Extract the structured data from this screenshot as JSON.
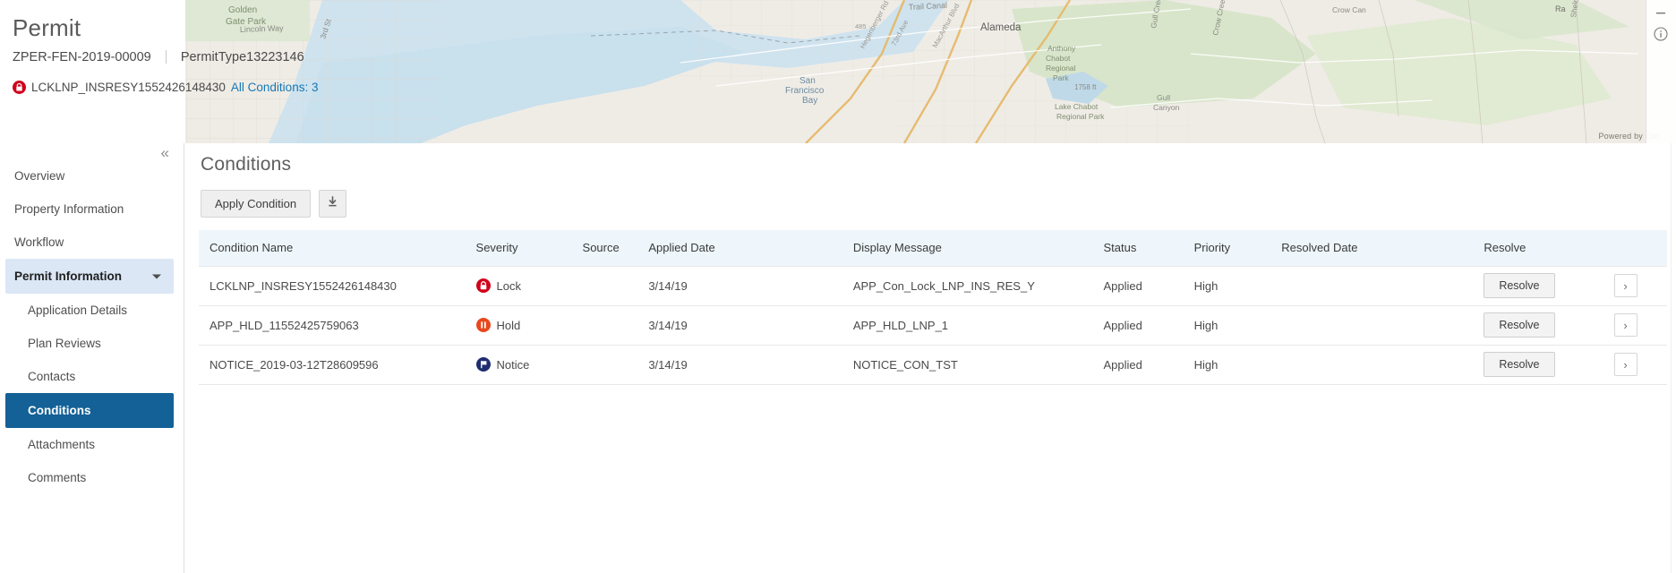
{
  "header": {
    "title": "Permit",
    "permit_number": "ZPER-FEN-2019-00009",
    "permit_type": "PermitType13223146",
    "condition_name": "LCKLNP_INSRESY1552426148430",
    "all_conditions_link": "All Conditions: 3",
    "lock_icon": "lock-badge-icon",
    "minimize_icon": "minimize-icon",
    "info_icon": "info-icon"
  },
  "map": {
    "attribution": "Powered by Esri",
    "labels": [
      "Golden Gate Park",
      "Lincoln Way",
      "3rd St",
      "Alameda",
      "San Francisco Bay",
      "Anthony Chabot Regional Park",
      "Lake Chabot Regional Park",
      "Gull Canyon",
      "Crow Creek",
      "Crow Canyon",
      "Sheldon Rd",
      "73rd Ave",
      "MacArthur Blvd",
      "Hegenberger Rd",
      "Trail Canal",
      "1758 ft",
      "Ra"
    ]
  },
  "sidebar": {
    "collapse_icon": "chevron-double-left-icon",
    "items": [
      {
        "label": "Overview",
        "level": 1,
        "state": "normal"
      },
      {
        "label": "Property Information",
        "level": 1,
        "state": "normal"
      },
      {
        "label": "Workflow",
        "level": 1,
        "state": "normal"
      },
      {
        "label": "Permit Information",
        "level": 1,
        "state": "group"
      },
      {
        "label": "Application Details",
        "level": 2,
        "state": "normal"
      },
      {
        "label": "Plan Reviews",
        "level": 2,
        "state": "normal"
      },
      {
        "label": "Contacts",
        "level": 2,
        "state": "normal"
      },
      {
        "label": "Conditions",
        "level": 2,
        "state": "active"
      },
      {
        "label": "Attachments",
        "level": 2,
        "state": "normal"
      },
      {
        "label": "Comments",
        "level": 2,
        "state": "normal"
      }
    ]
  },
  "main": {
    "title": "Conditions",
    "apply_condition_label": "Apply Condition",
    "download_icon": "download-icon",
    "chevron_right_icon": "chevron-right-icon"
  },
  "table": {
    "columns": [
      "Condition Name",
      "Severity",
      "Source",
      "Applied Date",
      "Display Message",
      "Status",
      "Priority",
      "Resolved Date",
      "Resolve",
      ""
    ],
    "rows": [
      {
        "condition_name": "LCKLNP_INSRESY1552426148430",
        "severity": "Lock",
        "severity_icon": "lock-icon",
        "severity_color": "#d0021b",
        "source": "",
        "applied_date": "3/14/19",
        "display_message": "APP_Con_Lock_LNP_INS_RES_Y",
        "status": "Applied",
        "priority": "High",
        "resolved_date": "",
        "resolve_label": "Resolve"
      },
      {
        "condition_name": "APP_HLD_11552425759063",
        "severity": "Hold",
        "severity_icon": "hold-icon",
        "severity_color": "#e8481c",
        "source": "",
        "applied_date": "3/14/19",
        "display_message": "APP_HLD_LNP_1",
        "status": "Applied",
        "priority": "High",
        "resolved_date": "",
        "resolve_label": "Resolve"
      },
      {
        "condition_name": "NOTICE_2019-03-12T28609596",
        "severity": "Notice",
        "severity_icon": "notice-flag-icon",
        "severity_color": "#1f2d70",
        "source": "",
        "applied_date": "3/14/19",
        "display_message": "NOTICE_CON_TST",
        "status": "Applied",
        "priority": "High",
        "resolved_date": "",
        "resolve_label": "Resolve"
      }
    ]
  },
  "colors": {
    "accent_blue": "#136196",
    "group_blue": "#dbe7f5",
    "header_blue": "#eef6fb",
    "link_blue": "#1678b5"
  }
}
